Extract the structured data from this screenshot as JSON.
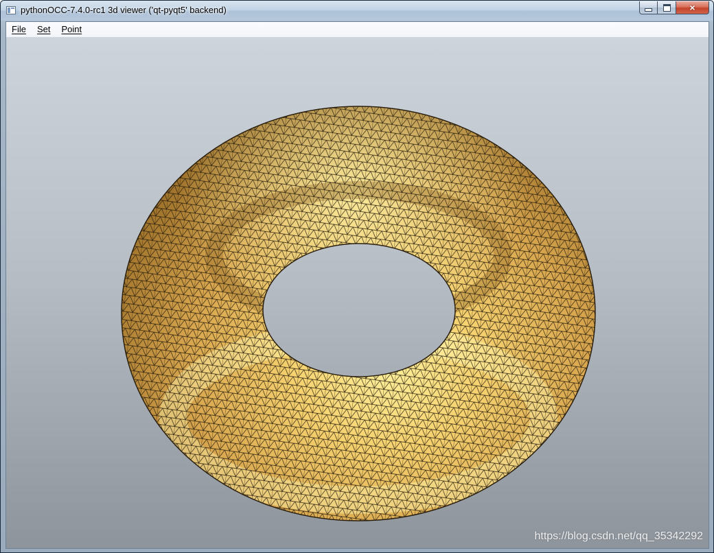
{
  "window": {
    "title": "pythonOCC-7.4.0-rc1 3d viewer ('qt-pyqt5' backend)",
    "icon": "app-window-icon",
    "controls": {
      "minimize": "minimize-icon",
      "maximize": "maximize-icon",
      "close": "×"
    }
  },
  "menubar": {
    "items": [
      {
        "label": "File"
      },
      {
        "label": "Set"
      },
      {
        "label": "Point"
      }
    ]
  },
  "viewport": {
    "object": "torus",
    "display_mode": "shaded-with-mesh",
    "colors": {
      "shape_base": "#d6a44c",
      "shape_highlight": "#fbe890",
      "mesh_edge": "#2a1f0e",
      "background_top": "#cdd4dc",
      "background_bottom": "#8e949c"
    }
  },
  "watermark": "https://blog.csdn.net/qq_35342292"
}
